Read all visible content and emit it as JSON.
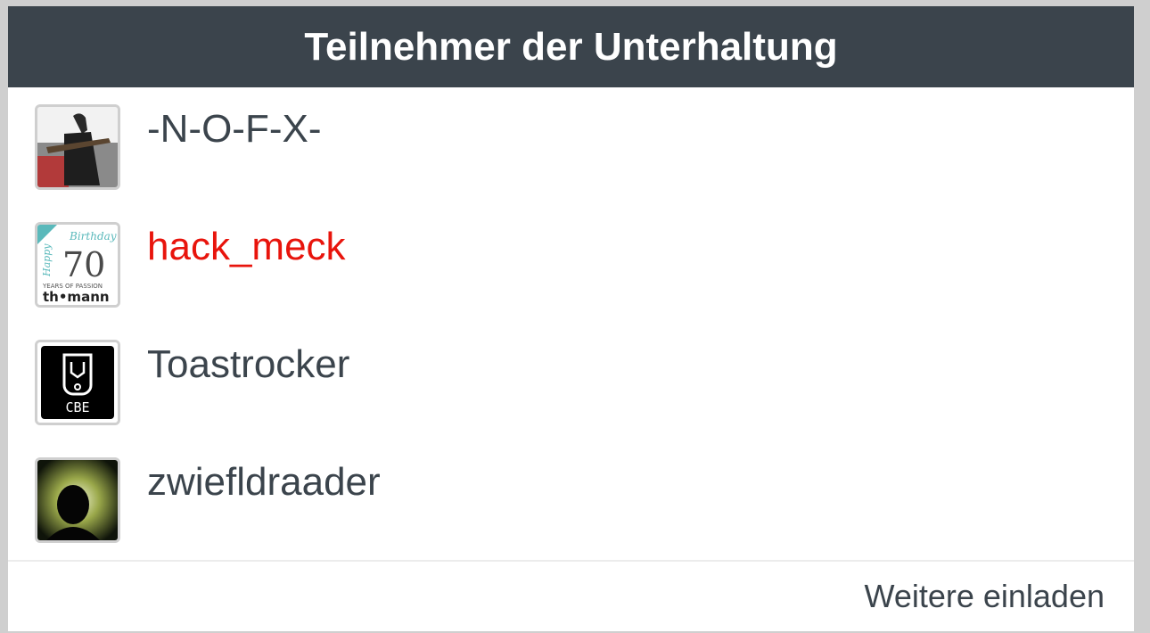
{
  "dialog": {
    "title": "Teilnehmer der Unterhaltung",
    "accent_color": "#3b444c",
    "highlight_color": "#e8140c"
  },
  "participants": [
    {
      "name": "-N-O-F-X-",
      "avatar_icon": "guitarist-photo-icon",
      "highlighted": false
    },
    {
      "name": "hack_meck",
      "avatar_icon": "thomann-70-birthday-logo-icon",
      "highlighted": true,
      "avatar_text": {
        "line1": "Birthday",
        "line2": "Happy",
        "number": "70",
        "tagline": "YEARS OF PASSION",
        "brand": "th•mann"
      }
    },
    {
      "name": "Toastrocker",
      "avatar_icon": "cbe-logo-icon",
      "highlighted": false,
      "avatar_text": {
        "label": "CBE"
      }
    },
    {
      "name": "zwiefldraader",
      "avatar_icon": "silhouette-photo-icon",
      "highlighted": false
    }
  ],
  "footer": {
    "invite_label": "Weitere einladen"
  }
}
